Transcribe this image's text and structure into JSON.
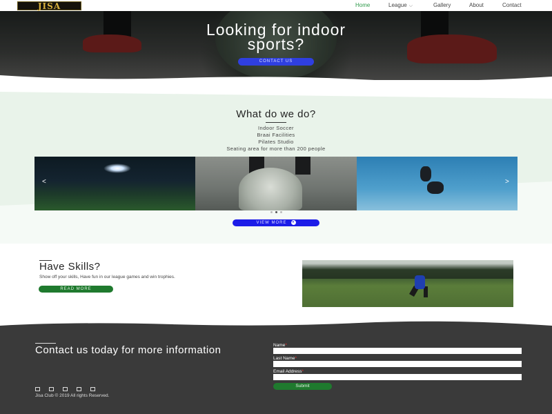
{
  "header": {
    "logo_text": "JISA",
    "nav": [
      {
        "label": "Home",
        "active": true
      },
      {
        "label": "League",
        "has_dropdown": true
      },
      {
        "label": "Gallery"
      },
      {
        "label": "About"
      },
      {
        "label": "Contact"
      }
    ]
  },
  "hero": {
    "title_line1": "Looking for indoor",
    "title_line2": "sports?",
    "button_label": "CONTACT US"
  },
  "what_we_do": {
    "title": "What do we do?",
    "services": [
      "Indoor Soccer",
      "Braai Facilities",
      "Pilates Studio",
      "Seating area for more than 200 people"
    ],
    "carousel": {
      "prev": "<",
      "next": ">",
      "slides": 3,
      "active_slide": 2
    },
    "button_label": "VIEW MORE"
  },
  "skills": {
    "title": "Have Skills?",
    "text": "Show off your skills, Have fun in our league games and win trophies.",
    "button_label": "READ MORE"
  },
  "footer": {
    "title": "Contact us today for more information",
    "socials": [
      "facebook-icon",
      "twitter-icon",
      "instagram-icon",
      "youtube-icon",
      "linkedin-icon"
    ],
    "copyright": "Jisa Club © 2019 All rights Reserved.",
    "form": {
      "name_label": "Name",
      "lastname_label": "Last Name",
      "email_label": "Email Address",
      "submit_label": "Submit"
    }
  },
  "colors": {
    "accent_green": "#2e9a4a",
    "button_blue": "#2f3fe0",
    "button_green": "#1f7a2e",
    "footer_bg": "#3a3a3a"
  }
}
